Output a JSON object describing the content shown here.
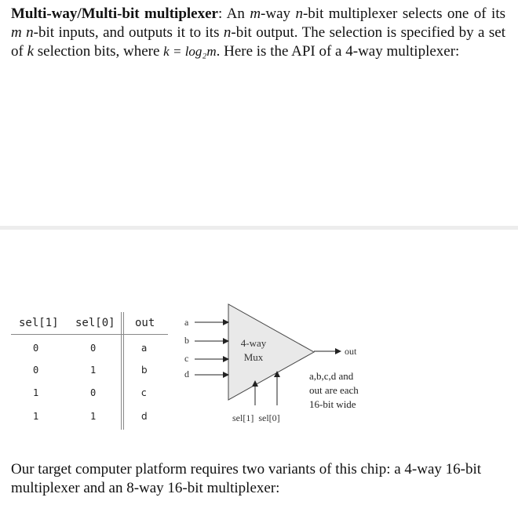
{
  "intro": {
    "term": "Multi-way/Multi-bit multiplexer",
    "t1": ": An ",
    "m1": "m",
    "t2": "-way ",
    "n1": "n",
    "t3": "-bit multiplexer selects one of its ",
    "m2": "m",
    "t4": " ",
    "n2": "n",
    "t5": "-bit inputs, and outputs it to its ",
    "n3": "n",
    "t6": "-bit output. The selection is specified by a set of ",
    "k1": "k",
    "t7": " selection bits, where ",
    "formula": "k = log₂m",
    "t8": ". Here is the API of a 4-way multiplexer:"
  },
  "truth_table": {
    "headers": [
      "sel[1]",
      "sel[0]",
      "out"
    ],
    "rows": [
      [
        "0",
        "0",
        "a"
      ],
      [
        "0",
        "1",
        "b"
      ],
      [
        "1",
        "0",
        "c"
      ],
      [
        "1",
        "1",
        "d"
      ]
    ]
  },
  "diagram": {
    "inputs": [
      "a",
      "b",
      "c",
      "d"
    ],
    "title_line1": "4-way",
    "title_line2": "Mux",
    "output": "out",
    "select_label": "sel[1]  sel[0]",
    "note": [
      "a,b,c,d and",
      "out are each",
      "16-bit wide"
    ]
  },
  "outro": "Our target computer platform requires two variants of this chip: a 4-way 16-bit multiplexer and an 8-way 16-bit multiplexer:"
}
